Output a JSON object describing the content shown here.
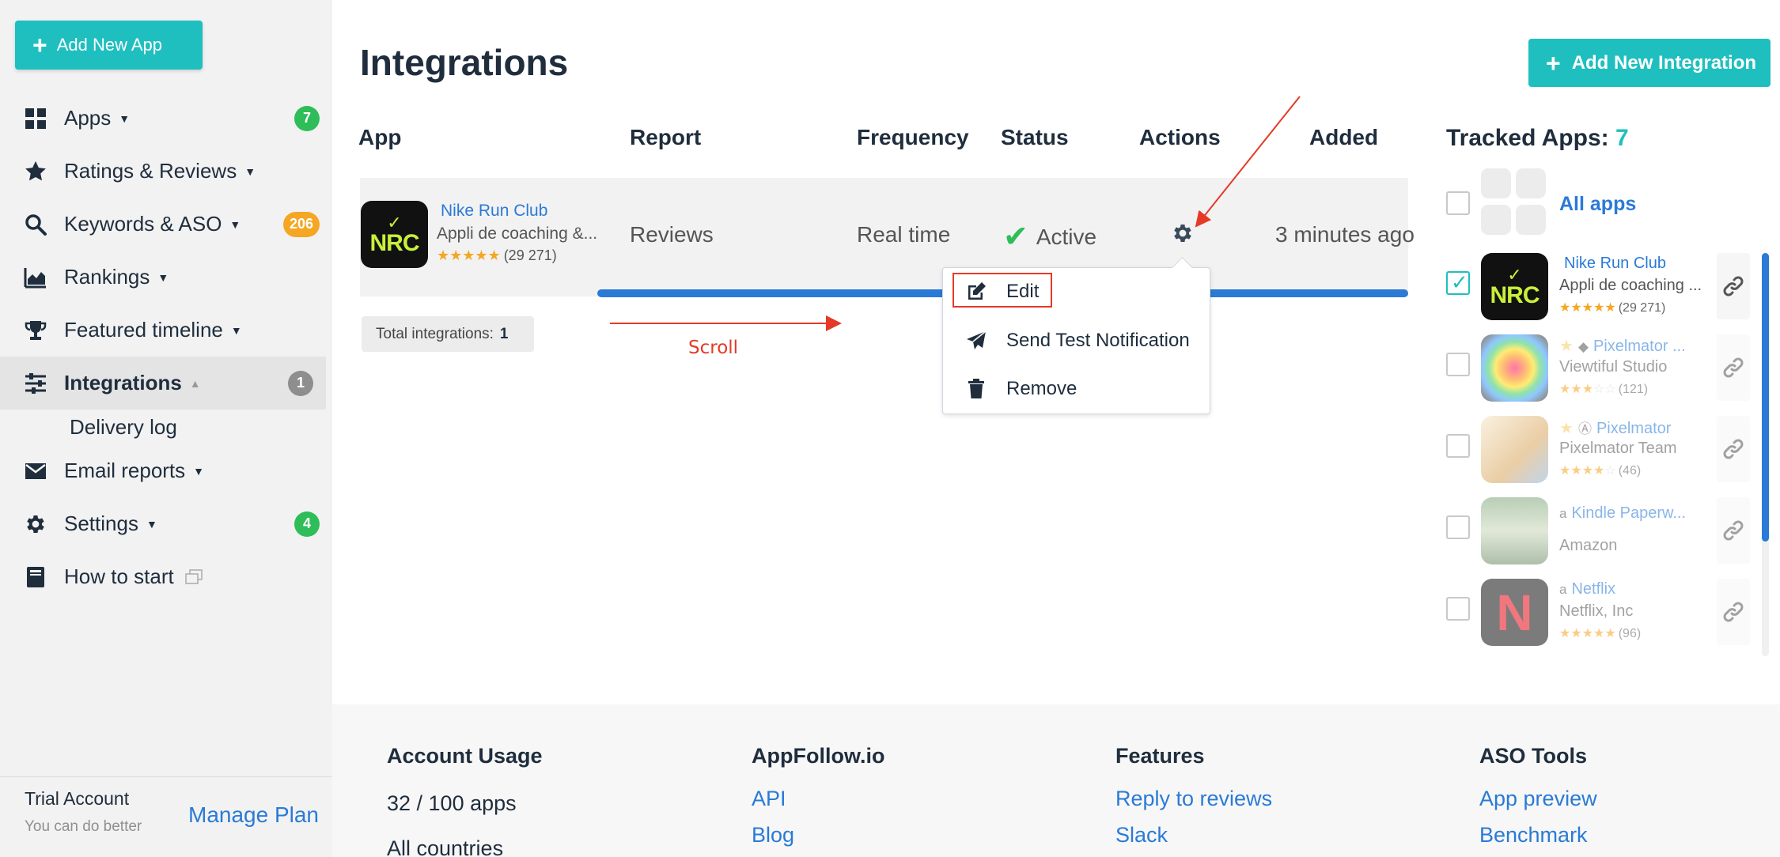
{
  "sidebar": {
    "add_app_label": "Add New App",
    "items": [
      {
        "label": "Apps",
        "badge": "7"
      },
      {
        "label": "Ratings & Reviews"
      },
      {
        "label": "Keywords & ASO",
        "badge": "206"
      },
      {
        "label": "Rankings"
      },
      {
        "label": "Featured timeline"
      },
      {
        "label": "Integrations",
        "badge": "1"
      },
      {
        "label": "Email reports"
      },
      {
        "label": "Settings",
        "badge": "4"
      },
      {
        "label": "How to start"
      }
    ],
    "subitem": "Delivery log",
    "trial_label": "Trial Account",
    "trial_sub": "You can do better",
    "manage_plan": "Manage Plan"
  },
  "main": {
    "title": "Integrations",
    "add_integration_label": "Add New Integration",
    "columns": [
      "App",
      "Report",
      "Frequency",
      "Status",
      "Actions",
      "Added"
    ],
    "row": {
      "app_name": "Nike Run Club",
      "app_desc": "Appli de coaching &...",
      "rating": 4.5,
      "rating_count": "(29 271)",
      "report": "Reviews",
      "frequency": "Real time",
      "status": "Active",
      "added": "3 minutes ago"
    },
    "total_label": "Total integrations:",
    "total_value": "1",
    "scroll_annotation": "Scroll"
  },
  "actions_menu": {
    "edit": "Edit",
    "send_test": "Send Test Notification",
    "remove": "Remove"
  },
  "tracked": {
    "title": "Tracked Apps:",
    "count": "7",
    "all_apps": "All apps",
    "apps": [
      {
        "name": "Nike Run Club",
        "dev": "Appli de coaching ...",
        "rating": 4.5,
        "count": "(29 271)",
        "checked": true,
        "platform": "apple"
      },
      {
        "name": "Pixelmator ...",
        "dev": "Viewtiful Studio",
        "rating": 3,
        "count": "(121)",
        "checked": false,
        "platform": "android"
      },
      {
        "name": "Pixelmator",
        "dev": "Pixelmator Team",
        "rating": 4,
        "count": "(46)",
        "checked": false,
        "platform": "appstore"
      },
      {
        "name": "Kindle Paperw...",
        "dev": "Amazon",
        "checked": false,
        "platform": "amazon"
      },
      {
        "name": "Netflix",
        "dev": "Netflix, Inc",
        "rating": 4.5,
        "count": "(96)",
        "checked": false,
        "platform": "amazon"
      }
    ]
  },
  "footer": {
    "account_usage": {
      "title": "Account Usage",
      "lines": [
        "32 / 100 apps",
        "All countries"
      ]
    },
    "appfollow": {
      "title": "AppFollow.io",
      "links": [
        "API",
        "Blog"
      ]
    },
    "features": {
      "title": "Features",
      "links": [
        "Reply to reviews",
        "Slack"
      ]
    },
    "aso_tools": {
      "title": "ASO Tools",
      "links": [
        "App preview",
        "Benchmark"
      ]
    }
  },
  "colors": {
    "accent": "#1fbfbf",
    "link": "#2a7ad6",
    "annotation": "#e53a26",
    "success": "#2ebd59",
    "warning": "#f5a623"
  }
}
